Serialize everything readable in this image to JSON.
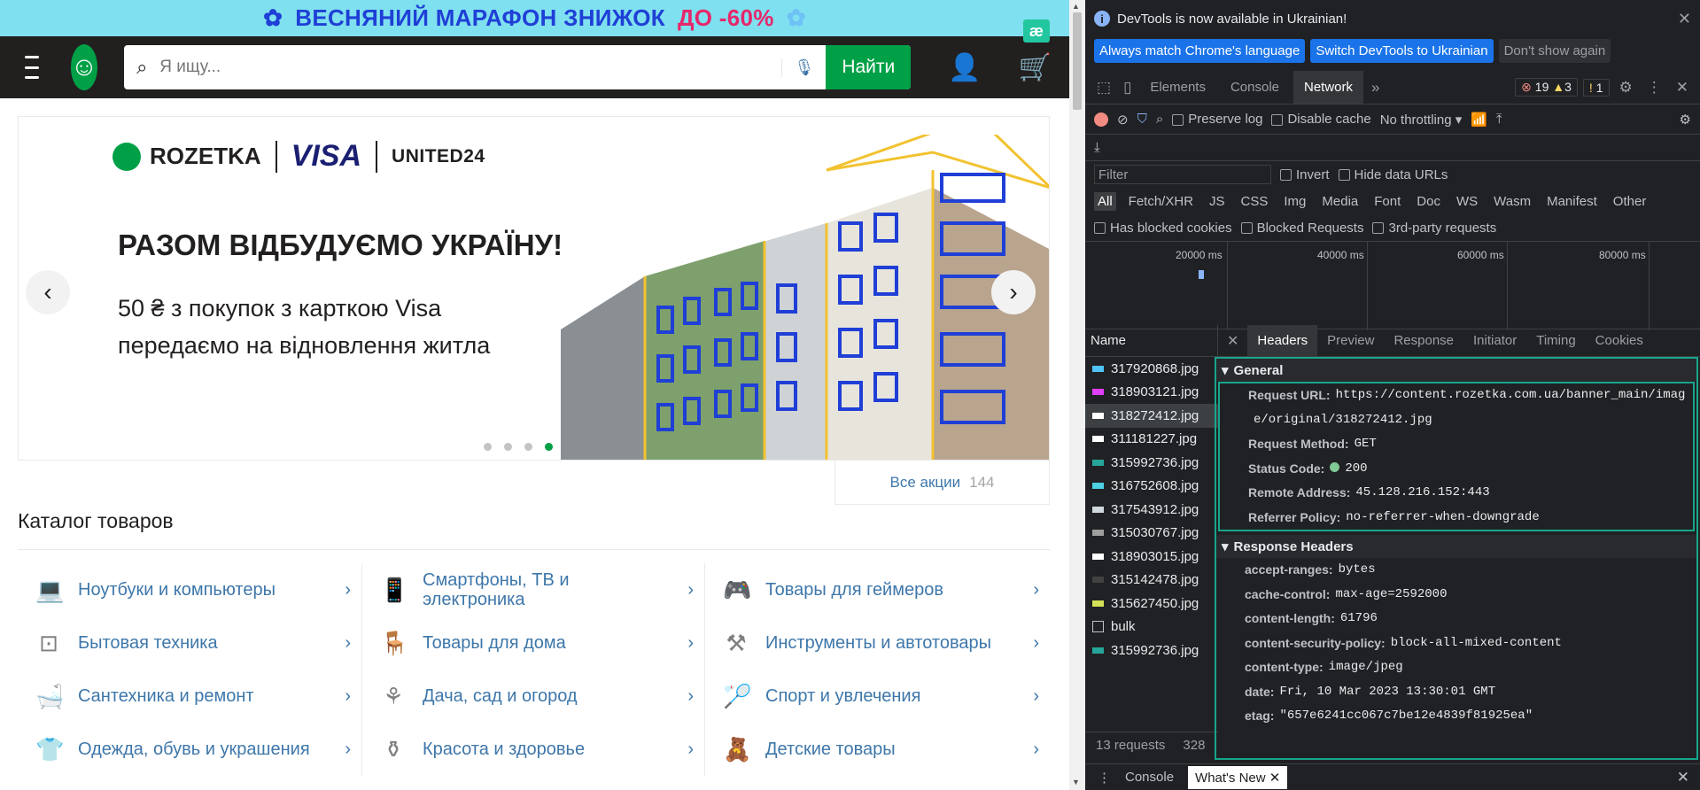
{
  "site": {
    "promo": {
      "pre": "ВЕСНЯНИЙ МАРАФОН ЗНИЖОК",
      "accent": "ДО -60%",
      "ae": "æ"
    },
    "search": {
      "placeholder": "Я ищу...",
      "button": "Найти"
    },
    "banner": {
      "logo_rozetka": "ROZETKA",
      "logo_visa": "VISA",
      "logo_u24": "UNITED24",
      "title": "РАЗОМ ВІДБУДУЄМО УКРАЇНУ!",
      "sub1": "50 ₴ з покупок з карткою Visa",
      "sub2": "передаємо на відновлення житла",
      "dots_active_index": 3
    },
    "all_promo": {
      "label": "Все акции",
      "count": "144"
    },
    "catalog_title": "Каталог товаров",
    "catalog": [
      {
        "label": "Ноутбуки и компьютеры",
        "icon": "laptop-icon"
      },
      {
        "label": "Смартфоны, ТВ и электроника",
        "icon": "smartphone-icon"
      },
      {
        "label": "Товары для геймеров",
        "icon": "gamepad-icon"
      },
      {
        "label": "Бытовая техника",
        "icon": "washer-icon"
      },
      {
        "label": "Товары для дома",
        "icon": "armchair-icon"
      },
      {
        "label": "Инструменты и автотовары",
        "icon": "drill-icon"
      },
      {
        "label": "Сантехника и ремонт",
        "icon": "bathtub-icon"
      },
      {
        "label": "Дача, сад и огород",
        "icon": "garden-tools-icon"
      },
      {
        "label": "Спорт и увлечения",
        "icon": "racket-icon"
      },
      {
        "label": "Одежда, обувь и украшения",
        "icon": "tshirt-icon"
      },
      {
        "label": "Красота и здоровье",
        "icon": "cosmetics-icon"
      },
      {
        "label": "Детские товары",
        "icon": "teddy-bear-icon"
      }
    ]
  },
  "devtools": {
    "info": "DevTools is now available in Ukrainian!",
    "btn_match": "Always match Chrome's language",
    "btn_switch": "Switch DevTools to Ukrainian",
    "btn_dismiss": "Don't show again",
    "tabs": [
      "Elements",
      "Console",
      "Network"
    ],
    "active_tab": "Network",
    "errors": "19",
    "warnings": "3",
    "issues": "1",
    "toolbar": {
      "preserve": "Preserve log",
      "disable_cache": "Disable cache",
      "throttle": "No throttling"
    },
    "filter": {
      "placeholder": "Filter",
      "invert": "Invert",
      "hide_data": "Hide data URLs"
    },
    "types": [
      "All",
      "Fetch/XHR",
      "JS",
      "CSS",
      "Img",
      "Media",
      "Font",
      "Doc",
      "WS",
      "Wasm",
      "Manifest",
      "Other"
    ],
    "checks": {
      "blocked_cookies": "Has blocked cookies",
      "blocked_req": "Blocked Requests",
      "third_party": "3rd-party requests"
    },
    "ticks": [
      "20000 ms",
      "40000 ms",
      "60000 ms",
      "80000 ms"
    ],
    "name_header": "Name",
    "requests": [
      {
        "name": "317920868.jpg",
        "color": "#4fc3f7"
      },
      {
        "name": "318903121.jpg",
        "color": "#e040fb"
      },
      {
        "name": "318272412.jpg",
        "color": "#ffffff"
      },
      {
        "name": "311181227.jpg",
        "color": "#ffffff"
      },
      {
        "name": "315992736.jpg",
        "color": "#26a69a"
      },
      {
        "name": "316752608.jpg",
        "color": "#4dd0e1"
      },
      {
        "name": "317543912.jpg",
        "color": "#cfd8dc"
      },
      {
        "name": "315030767.jpg",
        "color": "#9e9e9e"
      },
      {
        "name": "318903015.jpg",
        "color": "#ffffff"
      },
      {
        "name": "315142478.jpg",
        "color": "#424242"
      },
      {
        "name": "315627450.jpg",
        "color": "#d4e157"
      },
      {
        "name": "bulk",
        "color": "#202124"
      },
      {
        "name": "315992736.jpg",
        "color": "#26a69a"
      }
    ],
    "selected_request": 2,
    "status": "13 requests",
    "status2": "328",
    "detail_tabs": [
      "Headers",
      "Preview",
      "Response",
      "Initiator",
      "Timing",
      "Cookies"
    ],
    "general_title": "General",
    "general": [
      {
        "k": "Request URL:",
        "v": "https://content.rozetka.com.ua/banner_main/imag"
      },
      {
        "k": "",
        "v": "e/original/318272412.jpg"
      },
      {
        "k": "Request Method:",
        "v": "GET"
      },
      {
        "k": "Status Code:",
        "v": "200"
      },
      {
        "k": "Remote Address:",
        "v": "45.128.216.152:443"
      },
      {
        "k": "Referrer Policy:",
        "v": "no-referrer-when-downgrade"
      }
    ],
    "resp_title": "Response Headers",
    "response": [
      {
        "k": "accept-ranges:",
        "v": "bytes"
      },
      {
        "k": "cache-control:",
        "v": "max-age=2592000"
      },
      {
        "k": "content-length:",
        "v": "61796"
      },
      {
        "k": "content-security-policy:",
        "v": "block-all-mixed-content"
      },
      {
        "k": "content-type:",
        "v": "image/jpeg"
      },
      {
        "k": "date:",
        "v": "Fri, 10 Mar 2023 13:30:01 GMT"
      },
      {
        "k": "etag:",
        "v": "\"657e6241cc067c7be12e4839f81925ea\""
      }
    ],
    "drawer": {
      "console": "Console",
      "whatsnew": "What's New"
    }
  }
}
